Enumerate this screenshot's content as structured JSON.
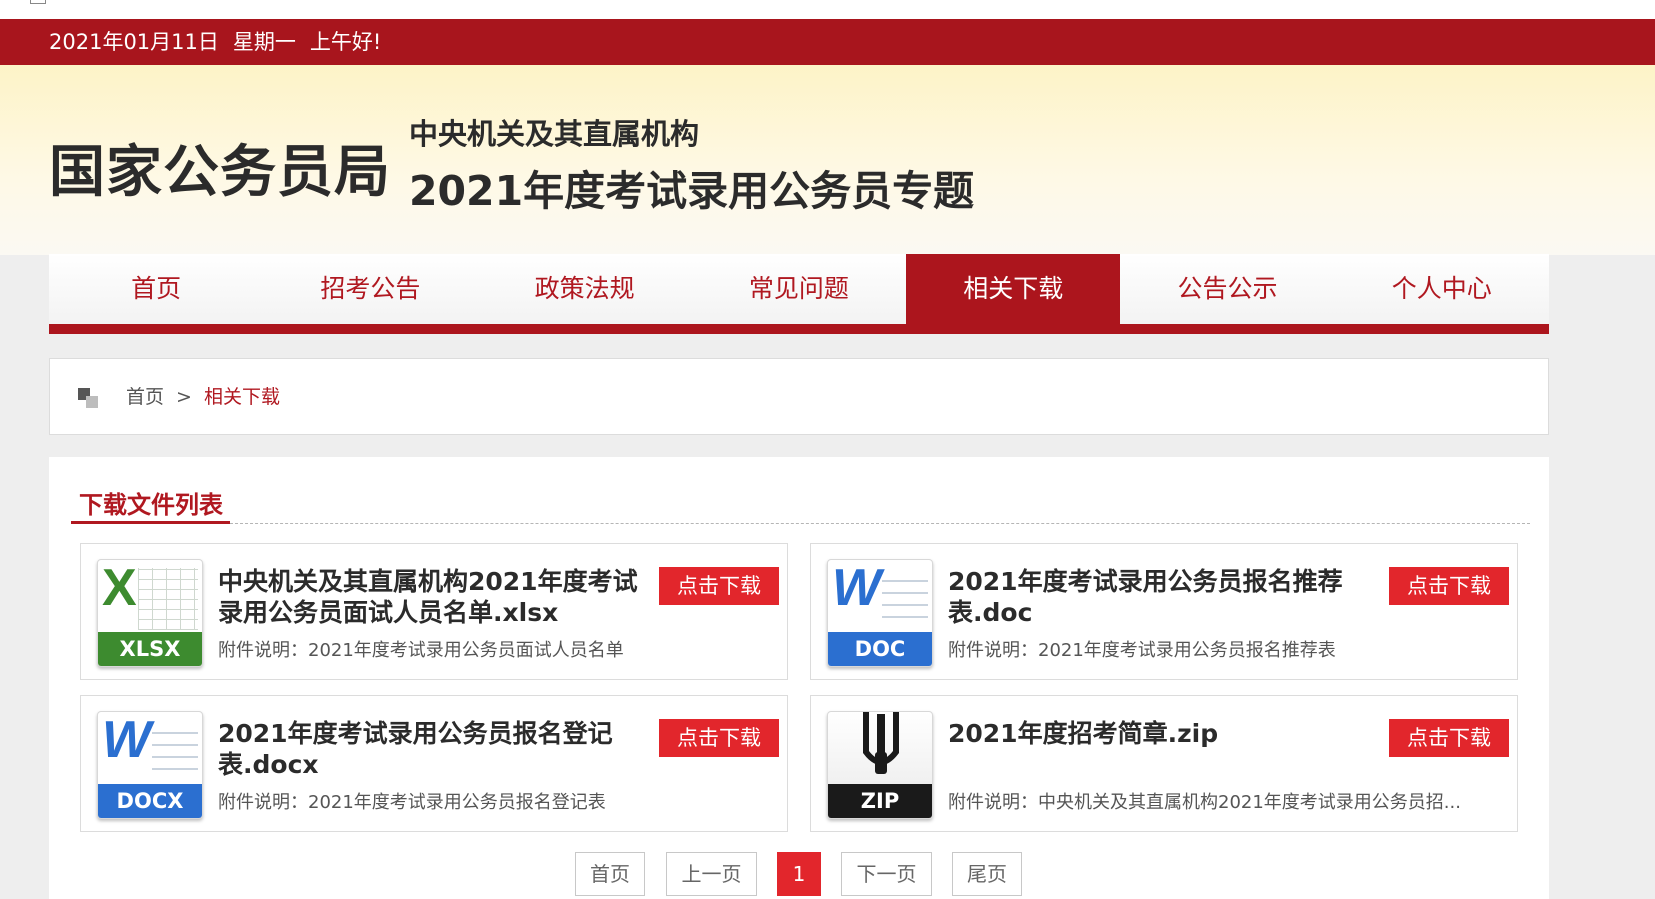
{
  "date_bar": {
    "date": "2021年01月11日",
    "weekday": "星期一",
    "greeting": "上午好!"
  },
  "banner": {
    "logo": "国家公务员局",
    "subtitle1": "中央机关及其直属机构",
    "subtitle2": "2021年度考试录用公务员专题"
  },
  "nav": {
    "items": [
      {
        "label": "首页"
      },
      {
        "label": "招考公告"
      },
      {
        "label": "政策法规"
      },
      {
        "label": "常见问题"
      },
      {
        "label": "相关下载",
        "active": true
      },
      {
        "label": "公告公示"
      },
      {
        "label": "个人中心"
      }
    ]
  },
  "breadcrumb": {
    "home": "首页",
    "separator": ">",
    "current": "相关下载"
  },
  "section": {
    "title": "下载文件列表"
  },
  "files": [
    {
      "title": "中央机关及其直属机构2021年度考试录用公务员面试人员名单.xlsx",
      "desc": "附件说明：2021年度考试录用公务员面试人员名单",
      "button": "点击下载",
      "icon": "xlsx-file-icon",
      "icon_label": "XLSX",
      "icon_letter": "X",
      "color": "#3d8b2f"
    },
    {
      "title": "2021年度考试录用公务员报名推荐表.doc",
      "desc": "附件说明：2021年度考试录用公务员报名推荐表",
      "button": "点击下载",
      "icon": "doc-file-icon",
      "icon_label": "DOC",
      "icon_letter": "W",
      "color": "#2b6fd0"
    },
    {
      "title": "2021年度考试录用公务员报名登记表.docx",
      "desc": "附件说明：2021年度考试录用公务员报名登记表",
      "button": "点击下载",
      "icon": "docx-file-icon",
      "icon_label": "DOCX",
      "icon_letter": "W",
      "color": "#2b6fd0"
    },
    {
      "title": "2021年度招考简章.zip",
      "desc": "附件说明：中央机关及其直属机构2021年度考试录用公务员招...",
      "button": "点击下载",
      "icon": "zip-file-icon",
      "icon_label": "ZIP",
      "icon_letter": "",
      "color": "#1a1a1a"
    }
  ],
  "pager": {
    "first": "首页",
    "prev": "上一页",
    "current": "1",
    "next": "下一页",
    "last": "尾页"
  },
  "colors": {
    "brand_red": "#a8151d",
    "button_red": "#e2262c"
  }
}
